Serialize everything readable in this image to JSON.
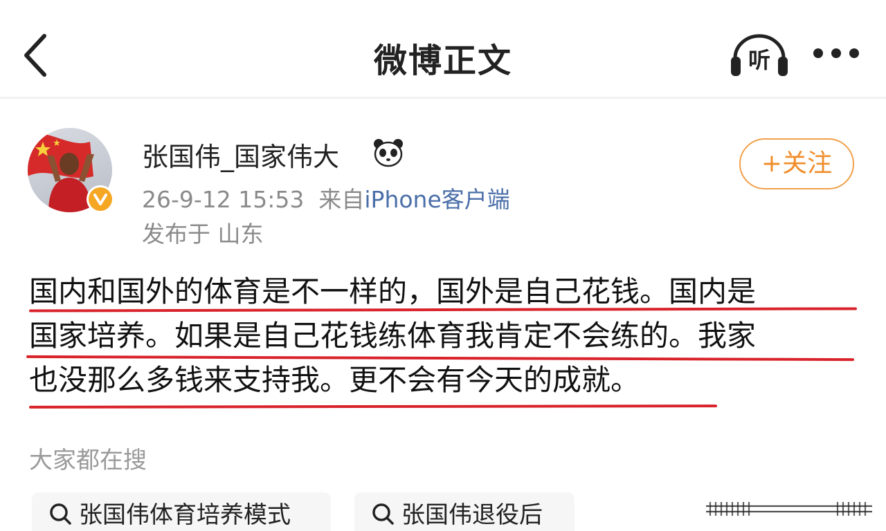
{
  "header": {
    "title": "微博正文",
    "back_icon": "chevron-left-icon",
    "listen_label": "听",
    "listen_icon": "headphones-icon",
    "more_icon": "more-dots-icon"
  },
  "author": {
    "name": "张国伟_国家伟大",
    "name_emoji_icon": "panda-icon",
    "verified_icon": "verified-v-icon",
    "timestamp": "26-9-12 15:53",
    "source_prefix": "来自",
    "source": "iPhone客户端",
    "location": "发布于 山东",
    "follow_label": "+关注"
  },
  "post": {
    "lines": [
      "国内和国外的体育是不一样的，国外是自己花钱。国内是",
      "国家培养。如果是自己花钱练体育我肯定不会练的。我家",
      "也没那么多钱来支持我。更不会有今天的成就。"
    ],
    "underline_color": "#d9232b"
  },
  "search": {
    "heading": "大家都在搜",
    "chips": [
      "张国伟体育培养模式",
      "张国伟退役后"
    ],
    "chip_icon": "search-icon"
  },
  "colors": {
    "accent_orange": "#f08d2a",
    "link_blue": "#4a6ea8",
    "underline_red": "#d9232b"
  }
}
